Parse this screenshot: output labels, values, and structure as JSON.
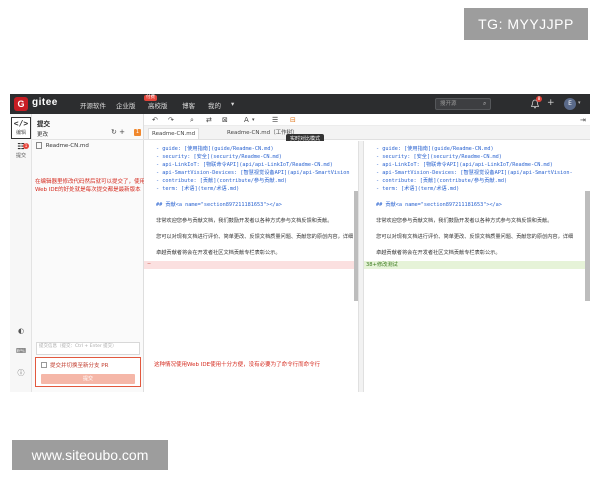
{
  "watermarks": {
    "top": "TG: MYYJJPP",
    "bottom": "www.siteoubo.com"
  },
  "topbar": {
    "logo_letter": "G",
    "brand": "gitee",
    "nav": [
      "开源软件",
      "企业版",
      "高校版",
      "博客",
      "我的"
    ],
    "enterprise_badge": "付费",
    "my_caret": "▾",
    "search_placeholder": "搜开源",
    "search_icon": "search-icon",
    "notification_count": "8",
    "add_symbol": "+",
    "avatar_letter": "E",
    "avatar_caret": "▾"
  },
  "activity_bar": {
    "items": [
      {
        "glyph": "</>",
        "label": "编辑"
      },
      {
        "glyph": "☷",
        "label": "提交",
        "count": "1"
      }
    ],
    "bottom_icons": [
      "palette-icon",
      "keyboard-icon",
      "info-icon"
    ]
  },
  "commit_panel": {
    "title": "提交",
    "changes_label": "更改",
    "refresh_glyph": "↻",
    "add_glyph": "+",
    "changes_count": "1",
    "file_name": "Readme-CN.md",
    "file_status": "M",
    "annotation": "在编辑器里修改代码然后就可以提交了，使用Web IDE的好处就是每次提交都是最新版本",
    "message_placeholder": "提交信息（提交：Ctrl + Enter 提交）",
    "commit_checkbox_label": "提交并切换至新分支 PR",
    "commit_button": "提交"
  },
  "toolbar": {
    "undo": "↶",
    "redo": "↷",
    "find": "⌕",
    "replace": "⇄",
    "diff": "⊠",
    "font": "A",
    "font_caret": "▾",
    "list": "☰",
    "compare": "⊟",
    "expand": "⇥"
  },
  "tabs": [
    {
      "label": "Readme-CN.md"
    },
    {
      "label": "Readme-CN.md（工作树）"
    }
  ],
  "tooltip": "实时对比模式",
  "left_lines": [
    {
      "gut": "",
      "text": "- guide: [使用指南](guide/Readme-CN.md)",
      "style": "blue"
    },
    {
      "gut": "",
      "text": "- security: [安全](security/Readme-CN.md)",
      "style": "blue"
    },
    {
      "gut": "",
      "text": "- api-LinkIoT: [物联命令API](api/api-LinkIoT/Readme-CN.md)",
      "style": "blue"
    },
    {
      "gut": "",
      "text": "- api-SmartVision-Devices: [智慧视觉设备API](api/api-SmartVision",
      "style": "blue"
    },
    {
      "gut": "",
      "text": "- contribute: [贡献](contribute/参与贡献.md)",
      "style": "blue"
    },
    {
      "gut": "",
      "text": "- term: [术语](term/术语.md)",
      "style": "blue"
    },
    {
      "gut": "",
      "text": "",
      "style": "blue"
    },
    {
      "gut": "",
      "text": "## 贡献<a name=\"section897211181653\"></a>",
      "style": "blue"
    },
    {
      "gut": "",
      "text": "",
      "style": "blue"
    },
    {
      "gut": "",
      "text": "非常欢迎您参与贡献文档，我们鼓励开发者以各种方式参与文档反馈和贡献。",
      "style": "dark"
    },
    {
      "gut": "",
      "text": "",
      "style": "dark"
    },
    {
      "gut": "",
      "text": "您可以对现有文档进行评价、简单更改、反馈文档质量问题、贡献您的原创内容，详细",
      "style": "dark"
    },
    {
      "gut": "",
      "text": "",
      "style": "dark"
    },
    {
      "gut": "",
      "text": "卓越贡献者将会在开发者社区文档贡献专栏表彰公示。",
      "style": "dark"
    }
  ],
  "right_lines": [
    {
      "gut": "",
      "text": "- guide: [使用指南](guide/Readme-CN.md)",
      "style": "blue"
    },
    {
      "gut": "",
      "text": "- security: [安全](security/Readme-CN.md)",
      "style": "blue"
    },
    {
      "gut": "",
      "text": "- api-LinkIoT: [物联命令API](api/api-LinkIoT/Readme-CN.md)",
      "style": "blue"
    },
    {
      "gut": "",
      "text": "- api-SmartVision-Devices: [智慧视觉设备API](api/api-SmartVision-",
      "style": "blue"
    },
    {
      "gut": "",
      "text": "- contribute: [贡献](contribute/参与贡献.md)",
      "style": "blue"
    },
    {
      "gut": "",
      "text": "- term: [术语](term/术语.md)",
      "style": "blue"
    },
    {
      "gut": "",
      "text": "",
      "style": "blue"
    },
    {
      "gut": "",
      "text": "## 贡献<a name=\"section897211181653\"></a>",
      "style": "blue"
    },
    {
      "gut": "",
      "text": "",
      "style": "blue"
    },
    {
      "gut": "",
      "text": "非常欢迎您参与贡献文档，我们鼓励开发者以各种方式参与文档反馈和贡献。",
      "style": "dark"
    },
    {
      "gut": "",
      "text": "",
      "style": "dark"
    },
    {
      "gut": "",
      "text": "您可以对现有文档进行评价、简单更改、反馈文档质量问题、贡献您的原创内容，详细",
      "style": "dark"
    },
    {
      "gut": "",
      "text": "",
      "style": "dark"
    },
    {
      "gut": "",
      "text": "卓越贡献者将会在开发者社区文档贡献专栏表彰公示。",
      "style": "dark"
    }
  ],
  "diff": {
    "deleted_gutter": "–",
    "added_text": "38+修改测试"
  },
  "middle_annotation": "这种情况使用Web IDE使用十分方便，没有必要为了命令行而命令行",
  "colors": {
    "brand_red": "#c71d23",
    "annotation_red": "#d52a1e",
    "topbar": "#2c2d2f",
    "deleted": "#fbe0e0",
    "added": "#e6f3d8"
  }
}
